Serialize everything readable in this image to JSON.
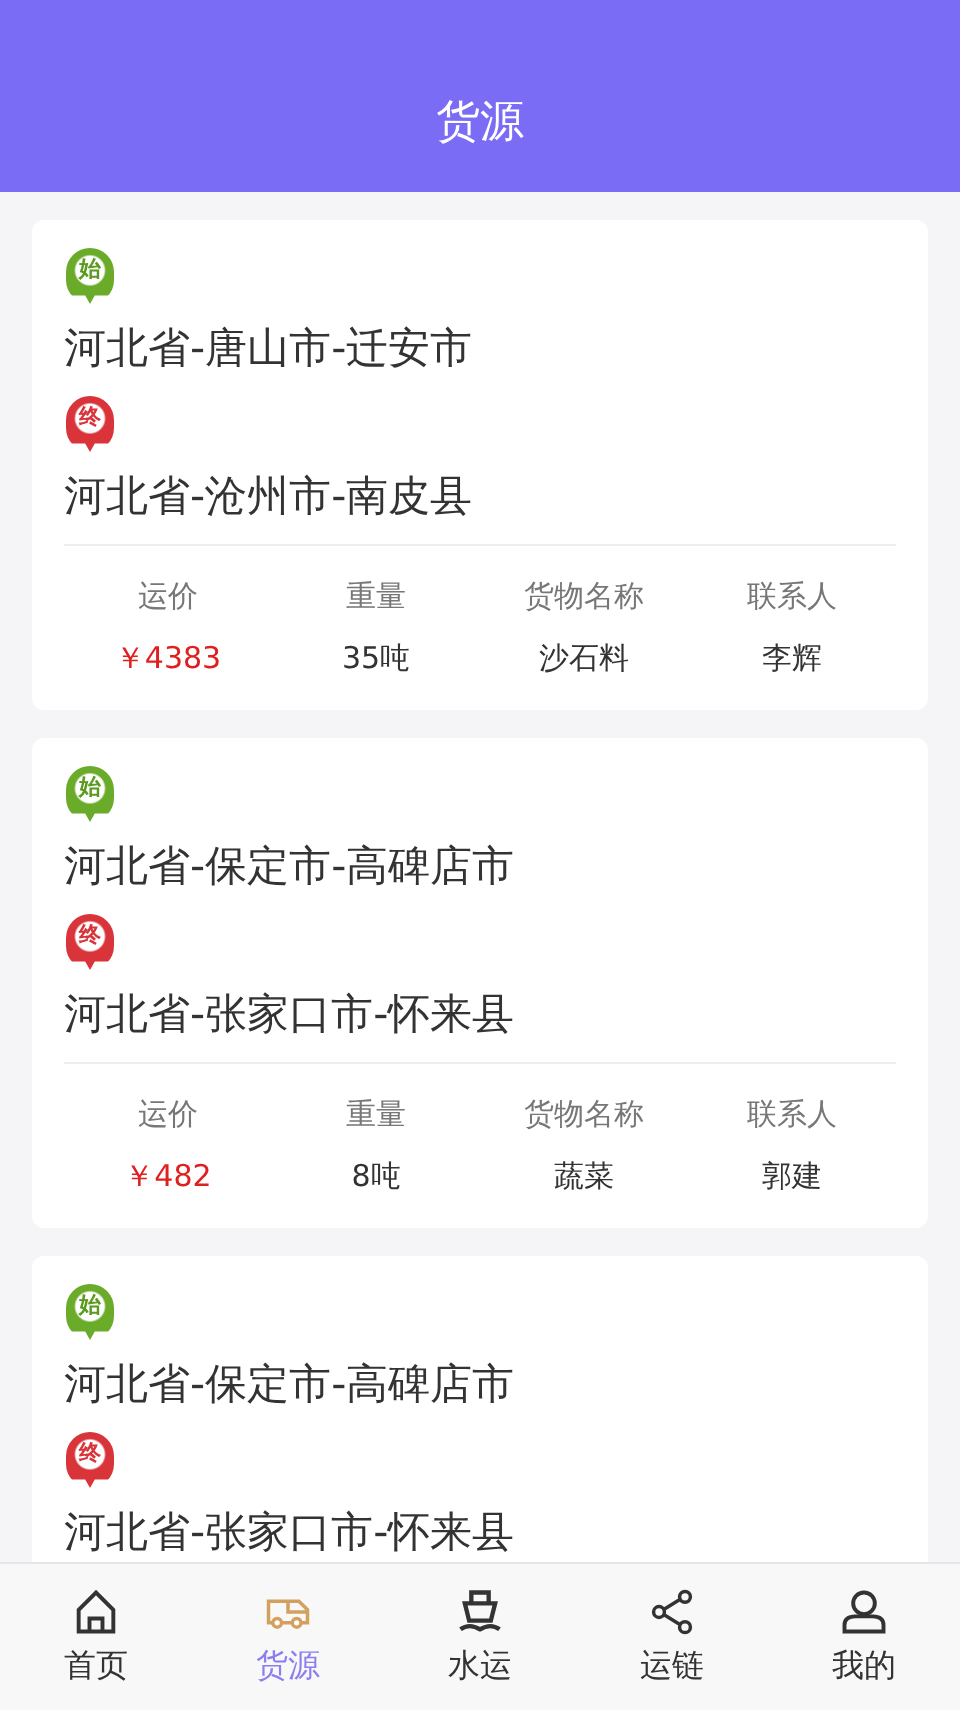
{
  "header": {
    "title": "货源"
  },
  "cards": [
    {
      "start": {
        "pin": "始",
        "address": "河北省-唐山市-迁安市"
      },
      "end": {
        "pin": "终",
        "address": "河北省-沧州市-南皮县"
      },
      "stats": [
        {
          "label": "运价",
          "value": "￥4383",
          "kind": "price"
        },
        {
          "label": "重量",
          "value": "35吨",
          "kind": "plain"
        },
        {
          "label": "货物名称",
          "value": "沙石料",
          "kind": "plain"
        },
        {
          "label": "联系人",
          "value": "李辉",
          "kind": "plain"
        }
      ]
    },
    {
      "start": {
        "pin": "始",
        "address": "河北省-保定市-高碑店市"
      },
      "end": {
        "pin": "终",
        "address": "河北省-张家口市-怀来县"
      },
      "stats": [
        {
          "label": "运价",
          "value": "￥482",
          "kind": "price"
        },
        {
          "label": "重量",
          "value": "8吨",
          "kind": "plain"
        },
        {
          "label": "货物名称",
          "value": "蔬菜",
          "kind": "plain"
        },
        {
          "label": "联系人",
          "value": "郭建",
          "kind": "plain"
        }
      ]
    },
    {
      "start": {
        "pin": "始",
        "address": "河北省-保定市-高碑店市"
      },
      "end": {
        "pin": "终",
        "address": "河北省-张家口市-怀来县"
      }
    }
  ],
  "tabbar": [
    {
      "label": "首页",
      "kind": "home",
      "selected": false
    },
    {
      "label": "货源",
      "kind": "truck",
      "selected": true
    },
    {
      "label": "水运",
      "kind": "ship",
      "selected": false
    },
    {
      "label": "运链",
      "kind": "share",
      "selected": false
    },
    {
      "label": "我的",
      "kind": "person",
      "selected": false
    }
  ]
}
